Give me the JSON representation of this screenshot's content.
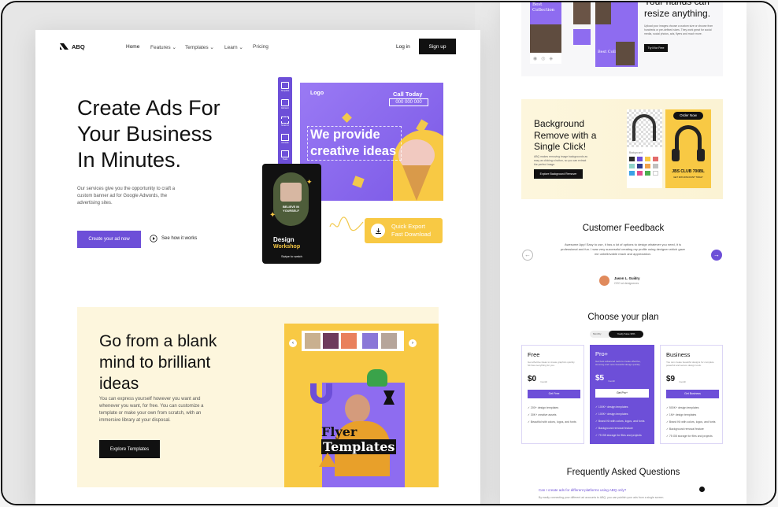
{
  "colors": {
    "accent": "#6d4fd8",
    "yellow": "#f8c944",
    "cream": "#fdf6dd",
    "dark": "#111111"
  },
  "nav": {
    "logo": "ABQ",
    "links": [
      "Home",
      "Features",
      "Templates",
      "Learn",
      "Pricing"
    ],
    "login": "Log in",
    "signup": "Sign up"
  },
  "hero": {
    "title_lines": [
      "Create Ads For",
      "Your Business",
      "In Minutes."
    ],
    "description": "Our services give you the opportunity to craft a custom banner ad for Google Adwords, the advertising sites.",
    "primary_cta": "Create your ad now",
    "secondary_cta": "See how it works"
  },
  "editor": {
    "tools": [
      "Template",
      "Element",
      "Smart AI",
      "Animate",
      "Tools"
    ],
    "banner_logo": "Logo",
    "call_today": "Call Today",
    "phone": "000 000 000",
    "headline_lines": [
      "We provide",
      "creative ideas"
    ],
    "card_badge_lines": [
      "BELIEVE IN",
      "YOURSELF"
    ],
    "card_title": "Design",
    "card_subtitle": "Workshop",
    "card_link": "Swipe to watch",
    "export_lines": [
      "Quick Export",
      "Fast Download"
    ]
  },
  "section2": {
    "title_lines": [
      "Go from a blank",
      "mind to brilliant",
      "ideas"
    ],
    "description": "You can express yourself however you want and whenever you want, for free. You can customize a template or make your own from scratch, with an immersive library at your disposal.",
    "cta": "Explore Templates",
    "poster_lines": [
      "Flyer",
      "Templates"
    ]
  },
  "resize": {
    "title_lines": [
      "Your hands can",
      "resize anything."
    ],
    "description": "Upload your images choose a custom size or choose from hundreds or pre-defined sizes. They work great for social media, social photos, ads, flyers and much more.",
    "cta": "Try it for Free",
    "tags": [
      "Best Collection",
      "Best Collection"
    ]
  },
  "bg_remove": {
    "title_lines": [
      "Background",
      "Remove with a",
      "Single Click!"
    ],
    "description": "ABQ makes removing image backgrounds as easy as clicking a button, so you can extract the perfect image.",
    "cta": "Explore Background Remover",
    "order_now": "Order Now",
    "product_title": "JBS CLUB 700BL",
    "product_subtitle": "GET 30% DISCOUNT TODAY",
    "swatch_label": "Background",
    "swatches": [
      "#2b2b2b",
      "#6d4fd8",
      "#f8c944",
      "#e36b6b",
      "#8fd3c9",
      "#2e3b8c",
      "#f2a14b",
      "#c0c0c0",
      "#3aa1e6",
      "#e24f8e",
      "#4caf50",
      "#ffffff"
    ]
  },
  "feedback": {
    "title": "Customer Feedback",
    "quote": "Awesome App! Easy to use, it has a lot of options to design whatever you need, it is professional and fun. I was very successful creating my profile using dexigner which gave me unbelievable reach and appreciation.",
    "name": "Jason L. Guidry",
    "role": "CEO at designenes"
  },
  "pricing": {
    "title": "Choose your plan",
    "toggle": [
      "Monthly",
      "Yearly Save 30%"
    ],
    "plans": [
      {
        "name": "Free",
        "desc": "Get effective ideas to create graphics quickly. Sit has everything for you.",
        "price": "$0",
        "per": "/month",
        "cta": "Get Free",
        "features": [
          "200+ design templates",
          "30K+ creative assets",
          "Beautiful with colors, logos, and fonts"
        ]
      },
      {
        "name": "Pro+",
        "desc": "Get best advanced tools to create effective, stunning and more beautiful design quickly.",
        "price": "$5",
        "per": "/month",
        "cta": "Get Pro+",
        "features": [
          "100K+ design templates",
          "100K+ design templates",
          "Brand Kit with colors, logos, and fonts",
          "Background removal feature",
          "75 GB storage for files and projects"
        ]
      },
      {
        "name": "Business",
        "desc": "You can create beautiful designs for complete powerful and secure design tools.",
        "price": "$9",
        "per": "/month",
        "cta": "Get Business",
        "features": [
          "500K+ design templates",
          "1M+ design templates",
          "Brand Kit with colors, logos, and fonts",
          "Background removal feature",
          "75 GB storage for files and projects"
        ]
      }
    ]
  },
  "faq": {
    "title": "Frequently Asked Questions",
    "question": "Can I create ads for different platforms using ABQ only?",
    "answer": "By easily connecting your different ad accounts to ABQ, you can publish your ads from a single screen."
  }
}
